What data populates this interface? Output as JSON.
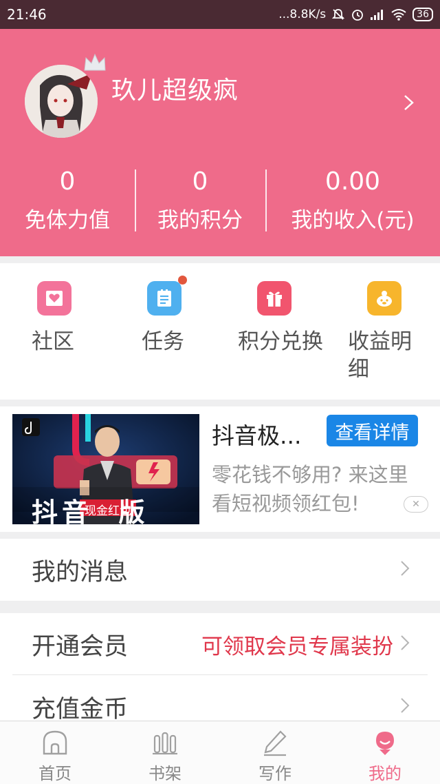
{
  "status_bar": {
    "time": "21:46",
    "network_speed": "...8.8K/s",
    "battery": "36"
  },
  "profile": {
    "username": "玖儿超级疯",
    "stats": [
      {
        "value": "0",
        "label": "免体力值"
      },
      {
        "value": "0",
        "label": "我的积分"
      },
      {
        "value": "0.00",
        "label": "我的收入(元)"
      }
    ]
  },
  "quick_entries": [
    {
      "label": "社区",
      "icon": "community-icon",
      "color": "#f3739a"
    },
    {
      "label": "任务",
      "icon": "task-list-icon",
      "color": "#4fb0ef",
      "badge": true
    },
    {
      "label": "积分兑换",
      "icon": "gift-icon",
      "color": "#f1556e"
    },
    {
      "label": "收益明细",
      "icon": "piggy-bank-icon",
      "color": "#f7b52c"
    }
  ],
  "ad": {
    "title": "抖音极...",
    "button": "查看详情",
    "description": "零花钱不够用? 来这里看短视频领红包!",
    "image_caption": "现金红包",
    "image_banner": "抖音  版"
  },
  "rows": {
    "messages": {
      "label": "我的消息"
    },
    "vip": {
      "label": "开通会员",
      "extra": "可领取会员专属装扮"
    },
    "recharge": {
      "label": "充值金币"
    }
  },
  "bottom_nav": [
    {
      "label": "首页",
      "icon": "home-icon"
    },
    {
      "label": "书架",
      "icon": "bookshelf-icon"
    },
    {
      "label": "写作",
      "icon": "pen-icon"
    },
    {
      "label": "我的",
      "icon": "profile-icon",
      "active": true
    }
  ],
  "colors": {
    "accent": "#ef6b8a",
    "status_bar": "#4a2a33",
    "ad_button": "#1a86e6",
    "vip_text": "#e0384c"
  }
}
